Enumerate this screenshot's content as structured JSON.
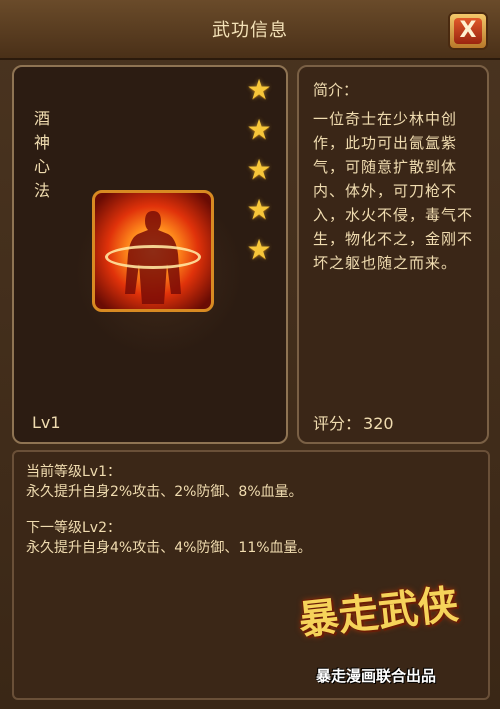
{
  "window": {
    "title": "武功信息",
    "close_label": "X"
  },
  "skill": {
    "name_chars": [
      "酒",
      "神",
      "心",
      "法"
    ],
    "level": "Lv1",
    "stars": 5,
    "icon": "fire-silhouette-icon"
  },
  "info": {
    "intro_label": "简介：",
    "intro_text": "一位奇士在少林中创作，此功可出氤氲紫气，可随意扩散到体内、体外，可刀枪不入，水火不侵，毒气不生，物化不之，金刚不坏之躯也随之而来。",
    "score_label": "评分：",
    "score_value": "320"
  },
  "effects": {
    "current_label": "当前等级Lv1：",
    "current_text": "永久提升自身2%攻击、2%防御、8%血量。",
    "next_label": "下一等级Lv2：",
    "next_text": "永久提升自身4%攻击、4%防御、11%血量。"
  },
  "watermark": {
    "title": "暴走武侠",
    "subtitle": "暴走漫画联合出品"
  },
  "colors": {
    "text": "#f0dcb0",
    "accent": "#f7c73a",
    "frame": "#8f7453"
  }
}
